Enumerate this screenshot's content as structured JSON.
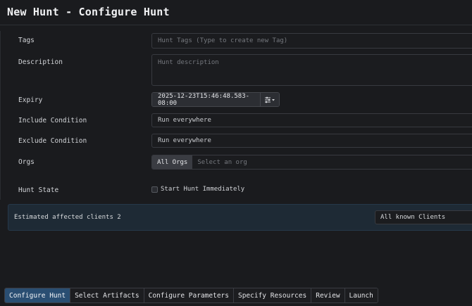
{
  "header": {
    "title": "New Hunt - Configure Hunt"
  },
  "form": {
    "tags": {
      "label": "Tags",
      "placeholder": "Hunt Tags (Type to create new Tag)"
    },
    "description": {
      "label": "Description",
      "placeholder": "Hunt description"
    },
    "expiry": {
      "label": "Expiry",
      "value": "2025-12-23T15:46:48.583-08:00",
      "button_icon": "sliders-icon"
    },
    "include_condition": {
      "label": "Include Condition",
      "value": "Run everywhere"
    },
    "exclude_condition": {
      "label": "Exclude Condition",
      "value": "Run everywhere"
    },
    "orgs": {
      "label": "Orgs",
      "button_label": "All Orgs",
      "placeholder": "Select an org"
    },
    "hunt_state": {
      "label": "Hunt State",
      "checkbox_label": "Start Hunt Immediately",
      "checked": false
    }
  },
  "estimate": {
    "text": "Estimated affected clients 2",
    "selected": "All known Clients"
  },
  "tabs": [
    {
      "label": "Configure Hunt",
      "active": true
    },
    {
      "label": "Select Artifacts",
      "active": false
    },
    {
      "label": "Configure Parameters",
      "active": false
    },
    {
      "label": "Specify Resources",
      "active": false
    },
    {
      "label": "Review",
      "active": false
    },
    {
      "label": "Launch",
      "active": false
    }
  ],
  "colors": {
    "accent": "#2a4e72",
    "background": "#1a1b1e",
    "estimate_bg": "#1e2a35"
  }
}
